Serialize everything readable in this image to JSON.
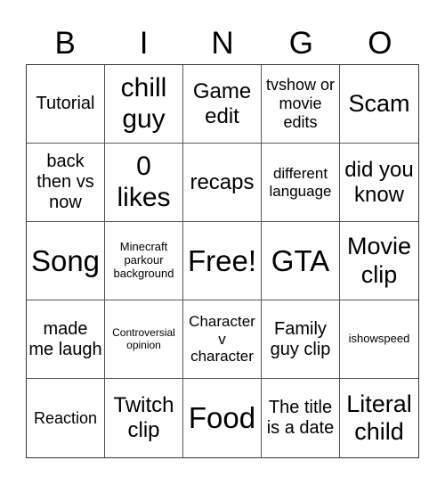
{
  "header": {
    "letters": [
      "B",
      "I",
      "N",
      "G",
      "O"
    ]
  },
  "cells": [
    "Tutorial",
    "chill guy",
    "Game edit",
    "tvshow or movie edits",
    "Scam",
    "back then vs now",
    "0 likes",
    "recaps",
    "different language",
    "did you know",
    "Song",
    "Minecraft parkour background",
    "Free!",
    "GTA",
    "Movie clip",
    "made me laugh",
    "Controversial opinion",
    "Character v character",
    "Family guy clip",
    "ishowspeed",
    "Reaction",
    "Twitch clip",
    "Food",
    "The title is a date",
    "Literal child"
  ]
}
